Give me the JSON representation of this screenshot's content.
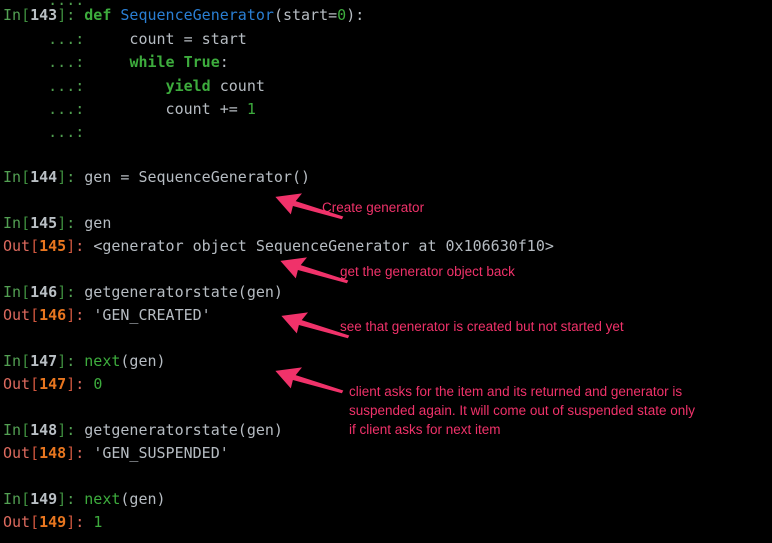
{
  "app": {
    "kind": "ipython-console",
    "background_color": "#000000",
    "prompt_in_color": "#53a053",
    "prompt_out_color": "#dd6a5e",
    "annotation_color": "#f0326a",
    "code_text_color": "#b6bcc2",
    "keyword_color": "#3dac3d",
    "function_name_color": "#2a7fd4"
  },
  "session": {
    "cells": [
      {
        "type": "partial-continuation",
        "prompt": "...:",
        "code": ""
      },
      {
        "type": "in",
        "prompt_word": "In",
        "number": "143",
        "segments": [
          {
            "text": "def ",
            "cls": "kw"
          },
          {
            "text": "SequenceGenerator",
            "cls": "fn"
          },
          {
            "text": "(start=",
            "cls": "txt"
          },
          {
            "text": "0",
            "cls": "numlit"
          },
          {
            "text": "):",
            "cls": "txt"
          }
        ]
      },
      {
        "type": "continuation",
        "prompt": "...:",
        "segments": [
          {
            "text": "    count = start",
            "cls": "txt"
          }
        ]
      },
      {
        "type": "continuation",
        "prompt": "...:",
        "segments": [
          {
            "text": "    ",
            "cls": "txt"
          },
          {
            "text": "while True",
            "cls": "kw"
          },
          {
            "text": ":",
            "cls": "txt"
          }
        ]
      },
      {
        "type": "continuation",
        "prompt": "...:",
        "segments": [
          {
            "text": "        ",
            "cls": "txt"
          },
          {
            "text": "yield",
            "cls": "kw"
          },
          {
            "text": " count",
            "cls": "txt"
          }
        ]
      },
      {
        "type": "continuation",
        "prompt": "...:",
        "segments": [
          {
            "text": "        count += ",
            "cls": "txt"
          },
          {
            "text": "1",
            "cls": "numlit"
          }
        ]
      },
      {
        "type": "continuation",
        "prompt": "...:",
        "segments": []
      },
      {
        "type": "in",
        "prompt_word": "In",
        "number": "144",
        "segments": [
          {
            "text": "gen = SequenceGenerator()",
            "cls": "txt"
          }
        ]
      },
      {
        "type": "in",
        "prompt_word": "In",
        "number": "145",
        "segments": [
          {
            "text": "gen",
            "cls": "txt"
          }
        ]
      },
      {
        "type": "out",
        "prompt_word": "Out",
        "number": "145",
        "segments": [
          {
            "text": "<generator object SequenceGenerator at 0x106630f10>",
            "cls": "txt"
          }
        ]
      },
      {
        "type": "in",
        "prompt_word": "In",
        "number": "146",
        "segments": [
          {
            "text": "getgeneratorstate(gen)",
            "cls": "txt"
          }
        ]
      },
      {
        "type": "out",
        "prompt_word": "Out",
        "number": "146",
        "segments": [
          {
            "text": "'GEN_CREATED'",
            "cls": "str"
          }
        ]
      },
      {
        "type": "in",
        "prompt_word": "In",
        "number": "147",
        "segments": [
          {
            "text": "next",
            "cls": "builtin"
          },
          {
            "text": "(gen)",
            "cls": "txt"
          }
        ]
      },
      {
        "type": "out",
        "prompt_word": "Out",
        "number": "147",
        "segments": [
          {
            "text": "0",
            "cls": "numlit"
          }
        ]
      },
      {
        "type": "in",
        "prompt_word": "In",
        "number": "148",
        "segments": [
          {
            "text": "getgeneratorstate(gen)",
            "cls": "txt"
          }
        ]
      },
      {
        "type": "out",
        "prompt_word": "Out",
        "number": "148",
        "segments": [
          {
            "text": "'GEN_SUSPENDED'",
            "cls": "str"
          }
        ]
      },
      {
        "type": "in",
        "prompt_word": "In",
        "number": "149",
        "segments": [
          {
            "text": "next",
            "cls": "builtin"
          },
          {
            "text": "(gen)",
            "cls": "txt"
          }
        ]
      },
      {
        "type": "out",
        "prompt_word": "Out",
        "number": "149",
        "segments": [
          {
            "text": "1",
            "cls": "numlit"
          }
        ]
      }
    ]
  },
  "annotations": [
    {
      "id": "note-create-generator",
      "text": "Create generator",
      "refers_to": "In [144] output of SequenceGenerator()"
    },
    {
      "id": "note-generator-object",
      "text": "get the generator object back",
      "refers_to": "Out [145] generator object repr"
    },
    {
      "id": "note-gen-created",
      "text": "see that generator is created but not started yet",
      "refers_to": "Out [146] 'GEN_CREATED'"
    },
    {
      "id": "note-gen-suspended",
      "text": "client asks for the item and its returned and generator is\nsuspended again. It will come out of suspended state only\nif client asks for next item",
      "refers_to": "Out [147] 0"
    }
  ]
}
